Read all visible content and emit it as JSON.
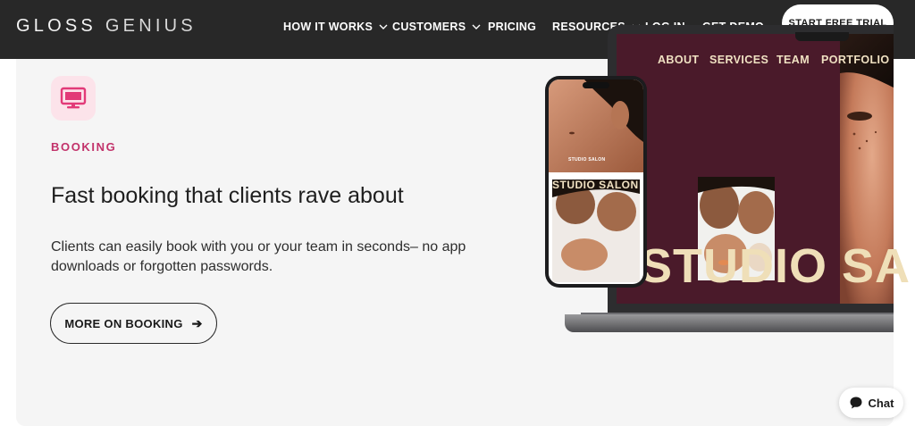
{
  "nav": {
    "logo_part1": "GLOSS",
    "logo_part2": "GENIUS",
    "items": [
      {
        "label": "HOW IT WORKS",
        "has_dropdown": true
      },
      {
        "label": "CUSTOMERS",
        "has_dropdown": true
      },
      {
        "label": "PRICING",
        "has_dropdown": false
      },
      {
        "label": "RESOURCES",
        "has_dropdown": true
      },
      {
        "label": "LOG IN",
        "has_dropdown": false
      },
      {
        "label": "GET DEMO",
        "has_dropdown": false
      }
    ],
    "cta_label": "START FREE TRIAL"
  },
  "feature": {
    "icon": "monitor-icon",
    "eyebrow": "BOOKING",
    "headline": "Fast booking that clients rave about",
    "description": "Clients can easily book with you or your team in seconds– no app downloads or forgotten passwords.",
    "button_label": "MORE ON BOOKING",
    "button_arrow": "➔"
  },
  "mockup": {
    "site_nav": [
      "ABOUT",
      "SERVICES",
      "TEAM",
      "PORTFOLIO"
    ],
    "brand_big": "STUDIO SA",
    "phone_brand_small": "STUDIO SALON",
    "phone_brand": "STUDIO SALON"
  },
  "chat": {
    "label": "Chat",
    "icon": "chat-bubble-icon"
  },
  "colors": {
    "nav_bg": "#282828",
    "card_bg": "#f5f5f5",
    "accent_pink": "#c2326a",
    "icon_tile_bg": "#fce3ea",
    "site_bg": "#4a1a2a",
    "site_text": "#f0e1c2"
  }
}
